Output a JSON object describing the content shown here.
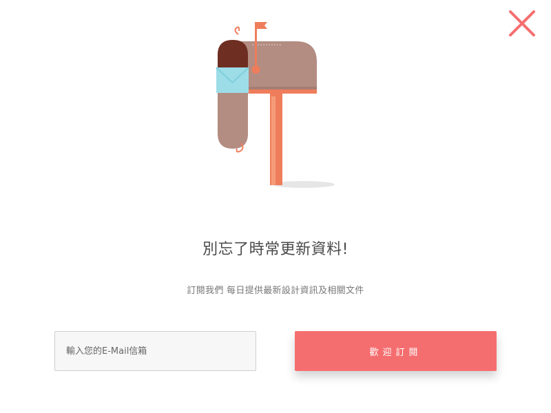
{
  "close": {
    "icon": "close-icon",
    "color": "#f56e6f"
  },
  "illustration": {
    "icon": "mailbox-icon"
  },
  "headline": "別忘了時常更新資料!",
  "subtext": "訂閱我們 每日提供最新設計資訊及相關文件",
  "form": {
    "email_placeholder": "輸入您的E-Mail信箱",
    "email_value": "",
    "subscribe_label": "歡迎訂閱"
  },
  "colors": {
    "accent": "#f56e6f",
    "mailbox_body": "#b38c82",
    "mailbox_post": "#ef7d5c",
    "envelope": "#9ddde8"
  }
}
